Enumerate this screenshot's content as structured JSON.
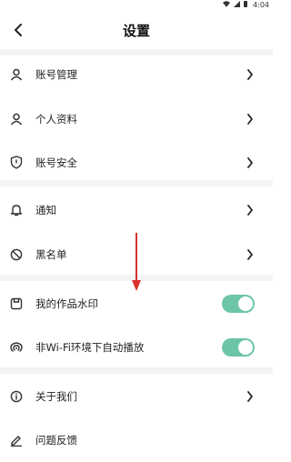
{
  "status_bar": {
    "time": "4:04"
  },
  "header": {
    "title": "设置"
  },
  "groups": [
    {
      "items": [
        {
          "label": "账号管理",
          "icon": "person-icon",
          "control": "chevron"
        },
        {
          "label": "个人资料",
          "icon": "person-icon",
          "control": "chevron"
        },
        {
          "label": "账号安全",
          "icon": "shield-icon",
          "control": "chevron"
        }
      ]
    },
    {
      "items": [
        {
          "label": "通知",
          "icon": "bell-icon",
          "control": "chevron"
        },
        {
          "label": "黑名单",
          "icon": "blocked-icon",
          "control": "chevron"
        }
      ]
    },
    {
      "items": [
        {
          "label": "我的作品水印",
          "icon": "watermark-icon",
          "control": "toggle",
          "toggle_on": true
        },
        {
          "label": "非Wi-Fi环境下自动播放",
          "icon": "broadcast-icon",
          "control": "toggle",
          "toggle_on": true
        }
      ]
    },
    {
      "items": [
        {
          "label": "关于我们",
          "icon": "info-icon",
          "control": "chevron"
        },
        {
          "label": "问题反馈",
          "icon": "edit-icon",
          "control": "none"
        }
      ]
    }
  ],
  "colors": {
    "toggle_on": "#6cc5a6",
    "annotation_arrow": "#d9302c",
    "group_gap": "#f3f4f6"
  }
}
